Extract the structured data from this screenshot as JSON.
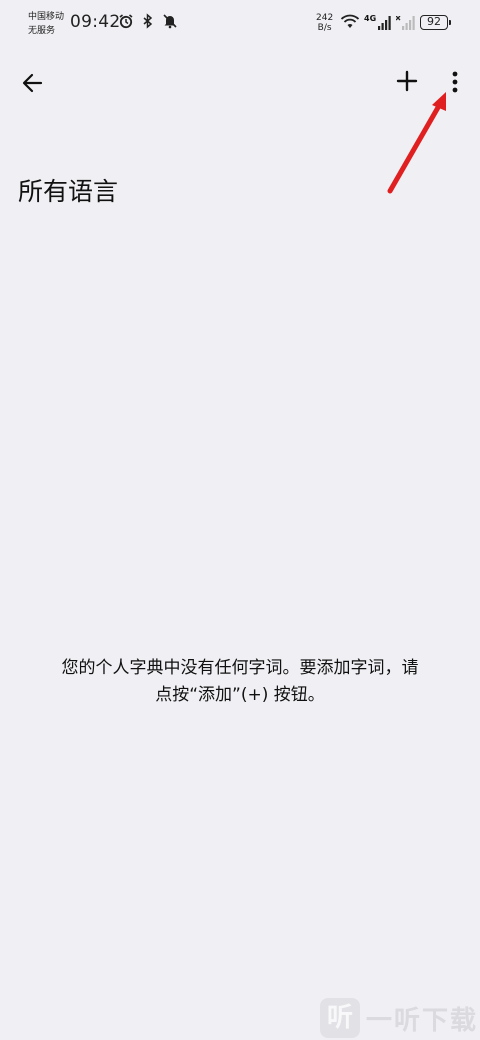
{
  "status_bar": {
    "carrier_line1": "中国移动",
    "carrier_line2": "无服务",
    "time": "09:42",
    "net_speed_value": "242",
    "net_speed_unit": "B/s",
    "network_type": "4G",
    "battery": "92",
    "icons": [
      "alarm-icon",
      "bluetooth-icon",
      "mute-icon",
      "wifi-icon",
      "signal-icon",
      "no-signal-icon"
    ]
  },
  "toolbar": {
    "back_icon": "arrow-left-icon",
    "add_icon": "plus-icon",
    "more_icon": "more-vertical-icon"
  },
  "page": {
    "title": "所有语言",
    "empty_line1": "您的个人字典中没有任何字词。要添加字词，请",
    "empty_line2": "点按“添加”(+) 按钮。"
  },
  "annotation": {
    "arrow_color": "#e02020"
  },
  "watermark": {
    "logo_char": "听",
    "text": "一听下载"
  }
}
